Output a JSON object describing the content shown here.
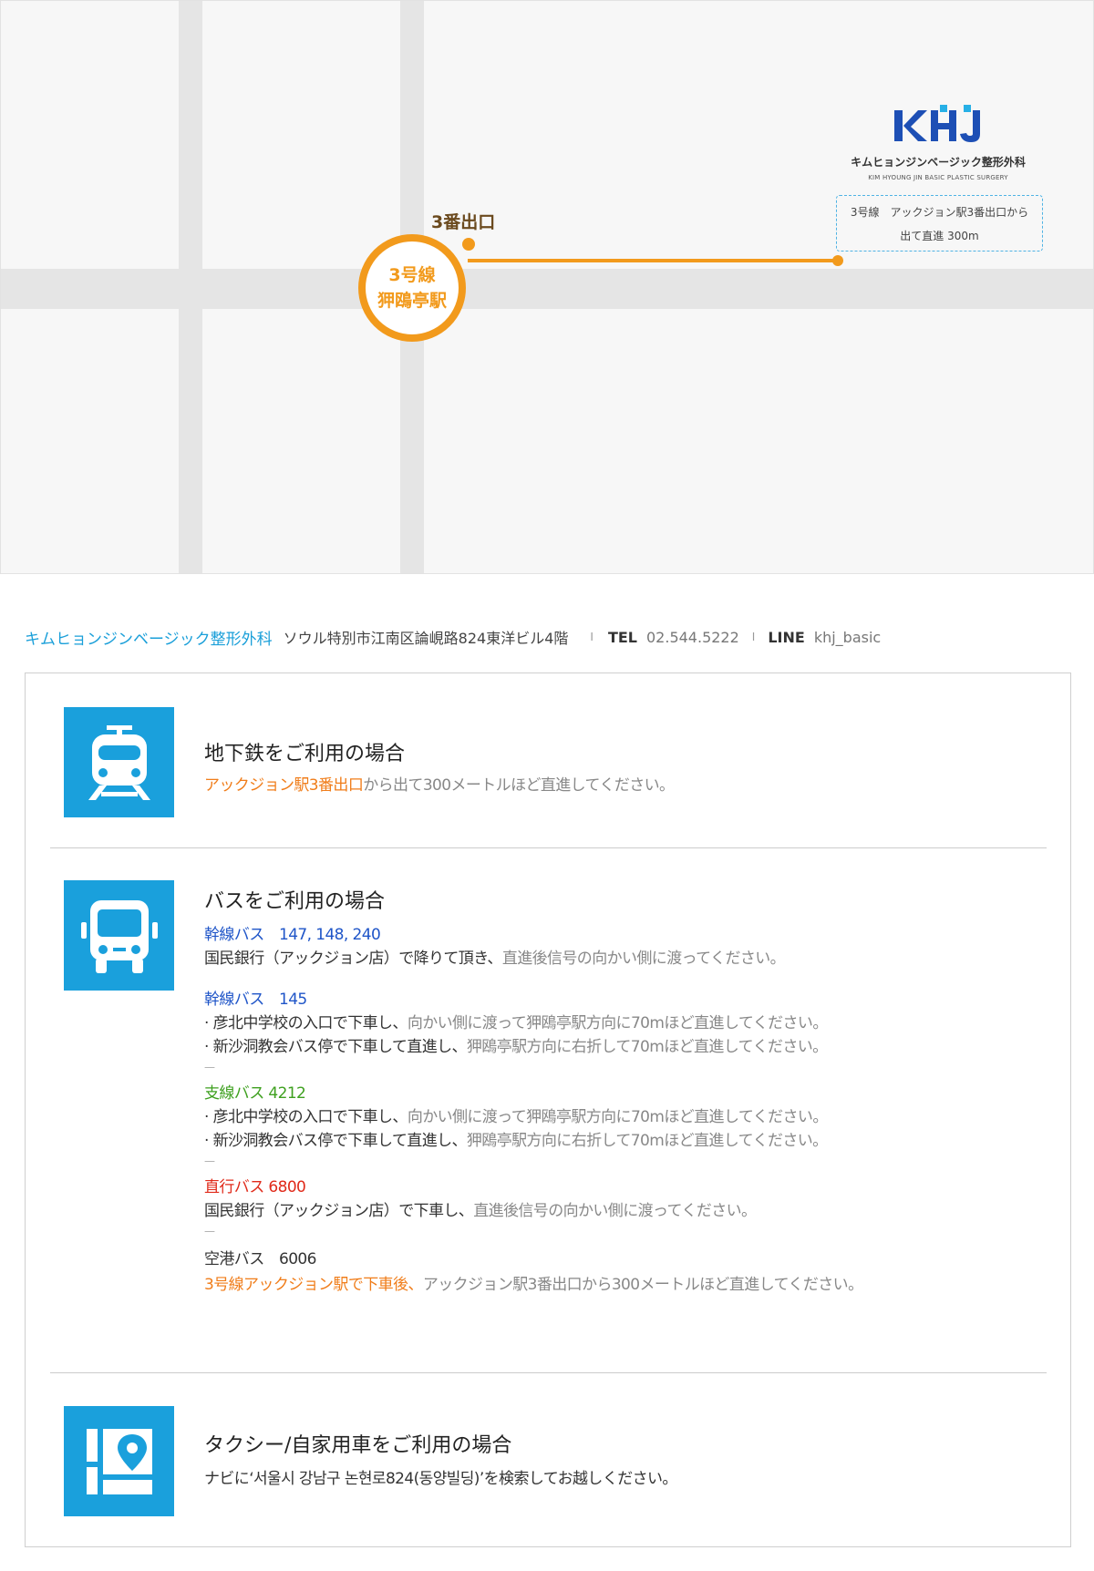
{
  "map": {
    "exit_label": "3番出口",
    "station_line": "3号線",
    "station_name": "狎鴎亭駅",
    "logo_text": "KHJ",
    "logo_name": "キムヒョンジンベージック整形外科",
    "logo_sub": "KIM HYOUNG JIN BASIC PLASTIC SURGERY",
    "callout_line1": "3号線　アックジョン駅3番出口から",
    "callout_line2": "出て直進 300m",
    "colors": {
      "route": "#f29a1c",
      "logo_blue": "#1d4fb5",
      "logo_accent": "#27b0e6"
    }
  },
  "address": {
    "brand": "キムヒョンジンベージック整形外科",
    "text": "ソウル特別市江南区論峴路824東洋ビル4階",
    "tel_label": "TEL",
    "tel_value": "02.544.5222",
    "line_label": "LINE",
    "line_value": "khj_basic",
    "separator": "I"
  },
  "subway": {
    "icon": "train-icon",
    "title": "地下鉄をご利用の場合",
    "highlight": "アックジョン駅3番出口",
    "rest": "から出て300メートルほど直進してください。"
  },
  "bus": {
    "icon": "bus-icon",
    "title": "バスをご利用の場合",
    "trunk1_label": "幹線バス　147, 148, 240",
    "trunk1_a": "国民銀行（アックジョン店）で降りて頂き、",
    "trunk1_b": "直進後信号の向かい側に渡ってください。",
    "trunk2_label": "幹線バス　145",
    "trunk2_l1a": "· 彦北中学校の入口で下車し、",
    "trunk2_l1b": "向かい側に渡って狎鴎亭駅方向に70mほど直進してください。",
    "trunk2_l2a": "· 新沙洞教会バス停で下車して直進し、",
    "trunk2_l2b": "狎鴎亭駅方向に右折して70mほど直進してください。",
    "branch_label": "支線バス 4212",
    "branch_l1a": "· 彦北中学校の入口で下車し、",
    "branch_l1b": "向かい側に渡って狎鴎亭駅方向に70mほど直進してください。",
    "branch_l2a": "· 新沙洞教会バス停で下車して直進し、",
    "branch_l2b": "狎鴎亭駅方向に右折して70mほど直進してください。",
    "express_label": "直行バス 6800",
    "express_a": "国民銀行（アックジョン店）で下車し、",
    "express_b": "直進後信号の向かい側に渡ってください。",
    "airport_label": "空港バス　6006",
    "airport_a": "3号線アックジョン駅で下車後、",
    "airport_b": "アックジョン駅3番出口から300メートルほど直進してください。",
    "dash": "—"
  },
  "taxi": {
    "icon": "map-pin-icon",
    "title": "タクシー/自家用車をご利用の場合",
    "text": "ナビに‘서울시 강남구 논현로824(동양빌딩)’を検索してお越しください。"
  }
}
